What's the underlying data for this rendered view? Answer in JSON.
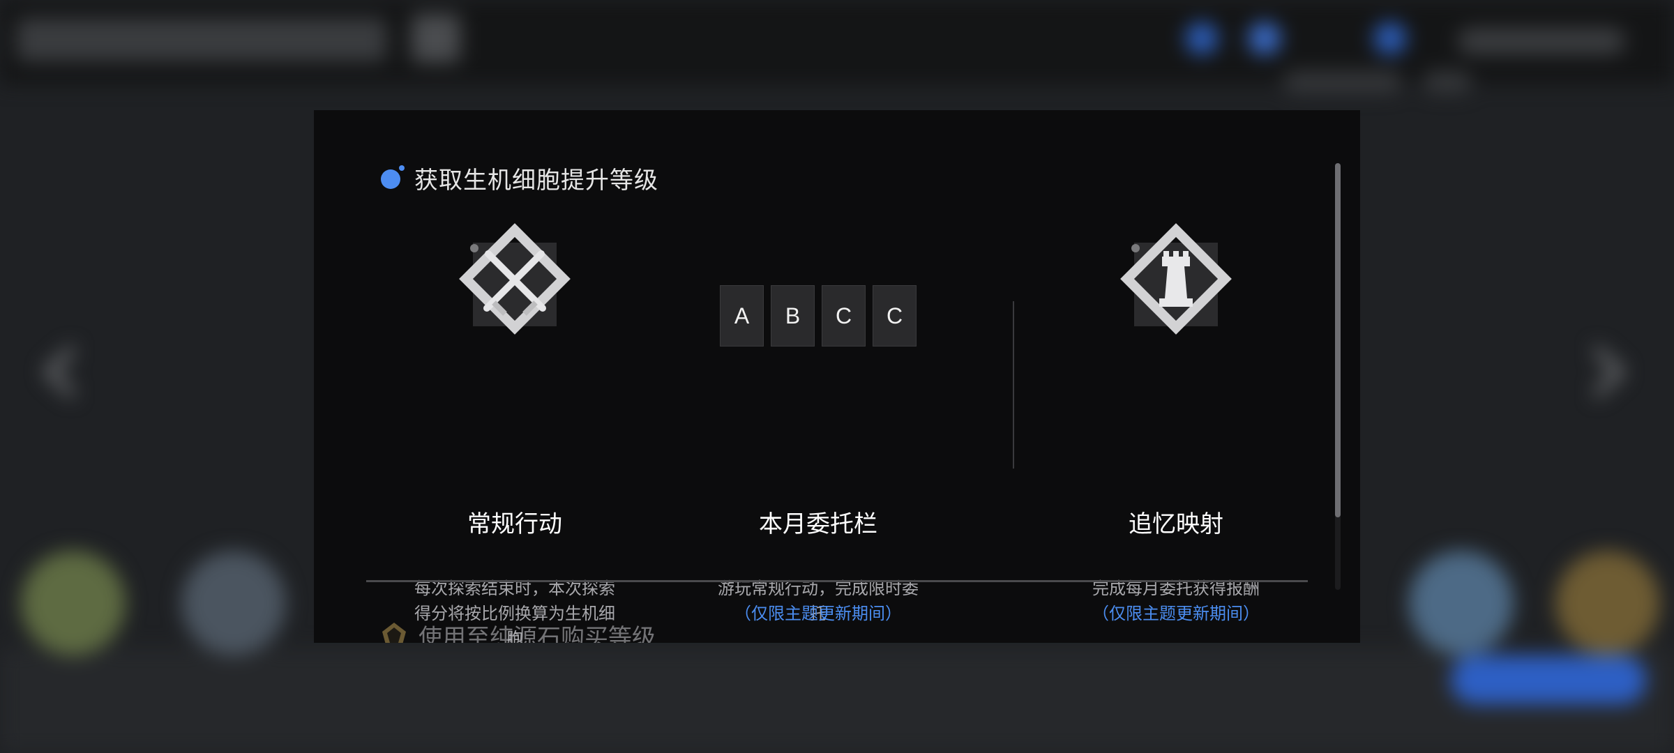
{
  "modal": {
    "section_title": "获取生机细胞提升等级",
    "next_section_title": "使用至纯源石购买等级",
    "columns": [
      {
        "icon": "crossed-swords-emblem-icon",
        "name": "常规行动",
        "description": "每次探索结束时，本次探索得分将按比例换算为生机细胞",
        "note": ""
      },
      {
        "icon": "grade-tiles",
        "grades": [
          "A",
          "B",
          "C",
          "C"
        ],
        "name": "本月委托栏",
        "description": "游玩常规行动，完成限时委托",
        "note": "（仅限主题更新期间）"
      },
      {
        "icon": "rook-tower-emblem-icon",
        "name": "追忆映射",
        "description": "完成每月委托获得报酬",
        "note": "（仅限主题更新期间）"
      }
    ]
  },
  "colors": {
    "accent_blue": "#4d8df2",
    "note_blue": "#4b8df0",
    "modal_bg": "#0c0c0d"
  }
}
